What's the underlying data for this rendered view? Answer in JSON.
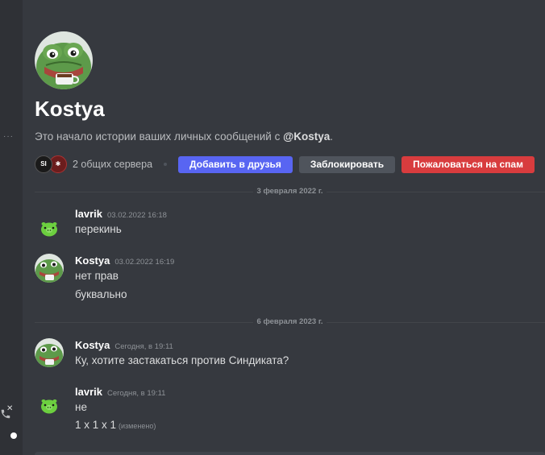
{
  "profile": {
    "username": "Kostya",
    "intro_prefix": "Это начало истории ваших личных сообщений с ",
    "intro_mention": "@Kostya",
    "intro_suffix": "."
  },
  "actions": {
    "mutual_servers": "2 общих сервера",
    "add_friend": "Добавить в друзья",
    "block": "Заблокировать",
    "report_spam": "Пожаловаться на спам"
  },
  "guild_icons": [
    "SI",
    "✱"
  ],
  "dividers": [
    "3 февраля 2022 г.",
    "6 февраля 2023 г."
  ],
  "messages": [
    {
      "author": "lavrik",
      "timestamp": "03.02.2022 16:18",
      "lines": [
        "перекинь"
      ]
    },
    {
      "author": "Kostya",
      "timestamp": "03.02.2022 16:19",
      "lines": [
        "нет прав",
        "буквально"
      ]
    },
    {
      "author": "Kostya",
      "timestamp": "Сегодня, в 19:11",
      "lines": [
        "Ку, хотите застакаться против Синдиката?"
      ]
    },
    {
      "author": "lavrik",
      "timestamp": "Сегодня, в 19:11",
      "lines": [
        "не",
        "1 x 1 x 1"
      ],
      "edited": "(изменено)"
    }
  ],
  "colors": {
    "background": "#36393f",
    "blurple": "#5865f2",
    "grey_button": "#4f545c",
    "red_button": "#d83c3e"
  }
}
